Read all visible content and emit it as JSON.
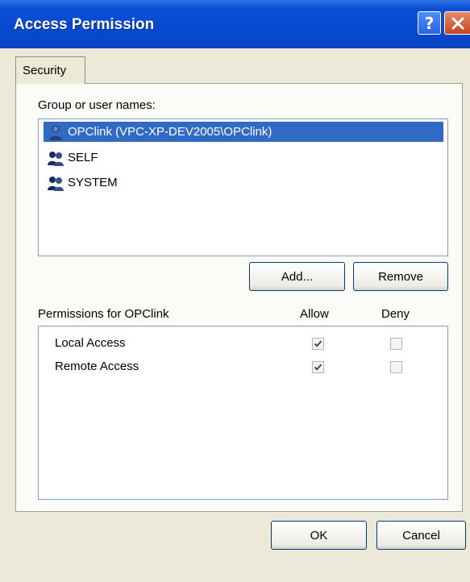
{
  "window": {
    "title": "Access Permission",
    "help_glyph": "?",
    "colors": {
      "titlebar": "#0649d0",
      "close": "#c8451c",
      "selection": "#316ac5"
    }
  },
  "tabs": [
    {
      "label": "Security"
    }
  ],
  "group_section": {
    "label": "Group or user names:",
    "users": [
      {
        "name": "OPClink (VPC-XP-DEV2005\\OPClink)",
        "icon": "user-icon",
        "selected": true
      },
      {
        "name": "SELF",
        "icon": "group-users-icon",
        "selected": false
      },
      {
        "name": "SYSTEM",
        "icon": "group-users-icon",
        "selected": false
      }
    ],
    "add_label": "Add...",
    "remove_label": "Remove"
  },
  "permissions": {
    "label": "Permissions for OPClink",
    "allow_header": "Allow",
    "deny_header": "Deny",
    "rows": [
      {
        "name": "Local Access",
        "allow": true,
        "deny": false
      },
      {
        "name": "Remote Access",
        "allow": true,
        "deny": false
      }
    ]
  },
  "footer": {
    "ok_label": "OK",
    "cancel_label": "Cancel"
  }
}
